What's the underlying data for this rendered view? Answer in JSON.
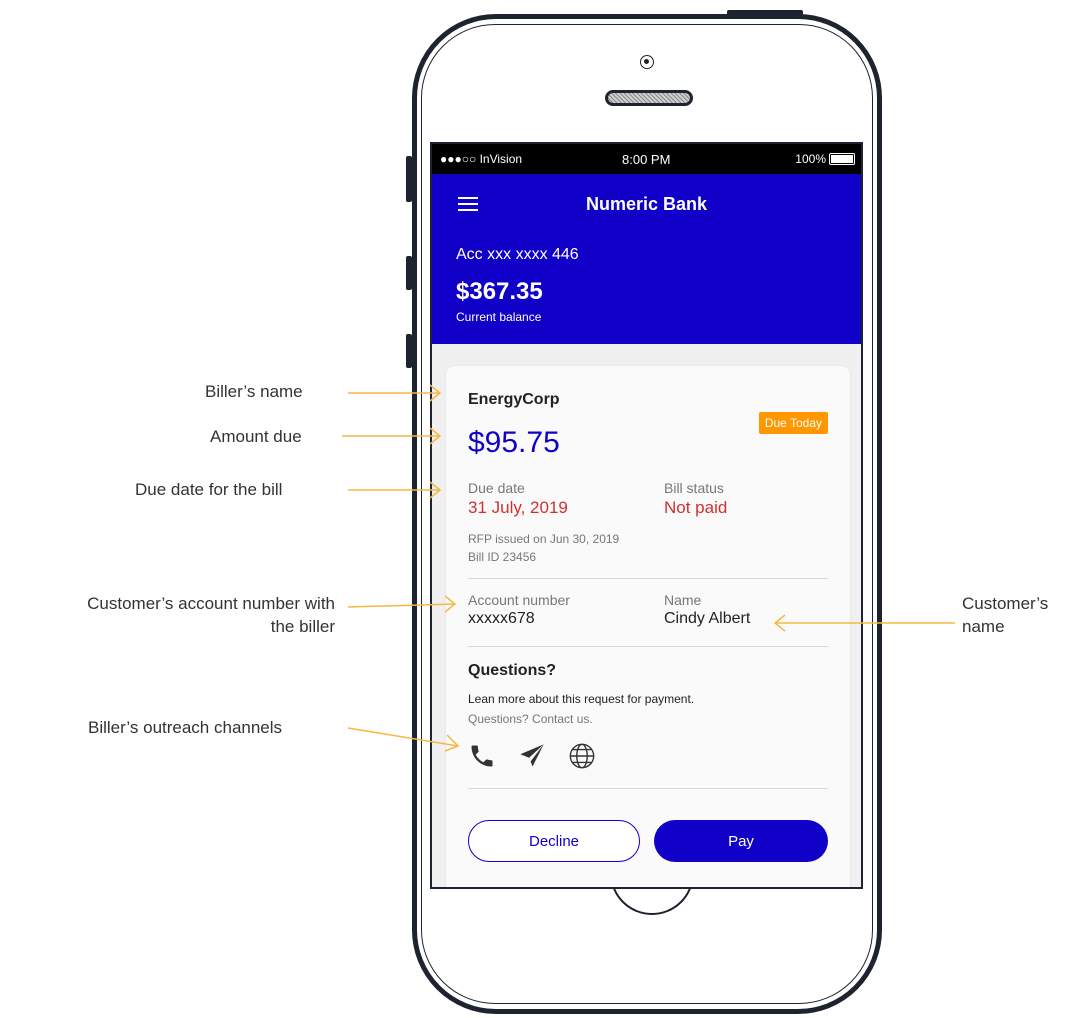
{
  "status_bar": {
    "carrier": "●●●○○ InVision",
    "time": "8:00 PM",
    "battery": "100%"
  },
  "header": {
    "bank_name": "Numeric Bank",
    "account": "Acc xxx xxxx 446",
    "balance": "$367.35",
    "balance_label": "Current balance"
  },
  "bill": {
    "biller_name": "EnergyCorp",
    "badge": "Due Today",
    "amount": "$95.75",
    "due_date_label": "Due date",
    "due_date": "31 July, 2019",
    "status_label": "Bill status",
    "status": "Not paid",
    "rfp_issued": "RFP issued on Jun 30, 2019",
    "bill_id": "Bill ID 23456",
    "account_label": "Account number",
    "account_number": "xxxxx678",
    "name_label": "Name",
    "customer_name": "Cindy Albert"
  },
  "questions": {
    "title": "Questions?",
    "text": "Lean more about this request for payment.",
    "contact": "Questions? Contact us.",
    "channels": [
      "phone-icon",
      "send-icon",
      "globe-icon"
    ]
  },
  "actions": {
    "decline": "Decline",
    "pay": "Pay"
  },
  "annotations": {
    "biller_name": "Biller’s name",
    "amount_due": "Amount due",
    "due_date": "Due date for the bill",
    "account_line1": "Customer’s account number with",
    "account_line2": "the biller",
    "channels": "Biller’s outreach channels",
    "customer_line1": "Customer’s",
    "customer_line2": "name"
  },
  "colors": {
    "brand": "#1000c8",
    "badge": "#ff9800",
    "alert": "#d32f2f",
    "annotation_arrow": "#f5b942"
  }
}
